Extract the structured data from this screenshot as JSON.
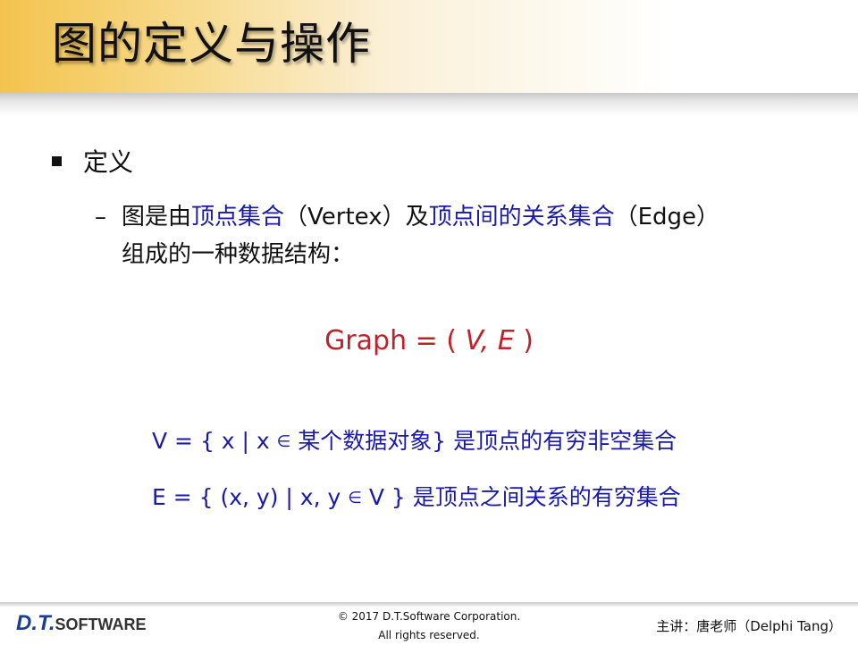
{
  "slide": {
    "title": "图的定义与操作",
    "bullet": "定义",
    "definition": {
      "dash": "–",
      "p1": "图是由",
      "hl1": "顶点集合",
      "p2": "（Vertex）及",
      "hl2": "顶点间的关系集合",
      "p3": "（Edge）",
      "line2": "组成的一种数据结构："
    },
    "formula": {
      "prefix": "Graph = (",
      "vars": "V, E",
      "suffix": ")"
    },
    "vertex_set": {
      "prefix": "V = { x | x",
      "symbol": "∈",
      "suffix": "某个数据对象} 是顶点的有穷非空集合"
    },
    "edge_set": {
      "prefix": "E = { (x, y) | x, y",
      "symbol": "∈",
      "suffix": "V } 是顶点之间关系的有穷集合"
    }
  },
  "footer": {
    "logo_main": "D.T.",
    "logo_sub": "SOFTWARE",
    "copyright_line1": "© 2017 D.T.Software Corporation.",
    "copyright_line2": "All rights reserved.",
    "presenter": "主讲：唐老师（Delphi Tang）"
  }
}
